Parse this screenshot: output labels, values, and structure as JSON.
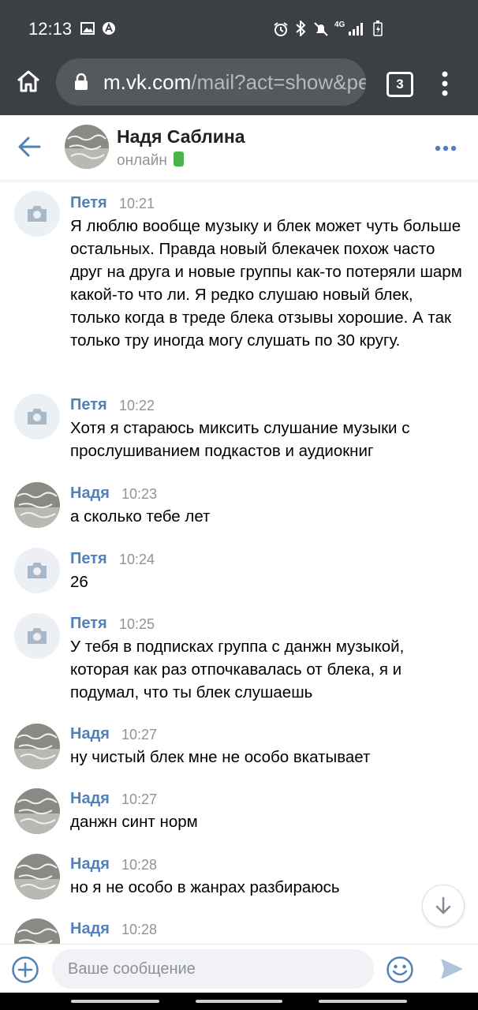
{
  "status_bar": {
    "time": "12:13",
    "network": "4G"
  },
  "browser": {
    "url_domain": "m.vk.com",
    "url_rest": "/mail?act=show&peer=",
    "tab_count": "3"
  },
  "chat_header": {
    "name": "Надя Саблина",
    "status": "онлайн"
  },
  "messages": [
    {
      "author": "Петя",
      "time": "10:21",
      "avatar": "camera",
      "text": "Я люблю вообще музыку и блек может чуть больше остальных. Правда новый блекачек похож часто друг на друга и новые группы как-то потеряли шарм какой-то что ли. Я редко слушаю новый блек, только когда в треде блека отзывы хорошие. А так только тру иногда могу слушать по 30 кругу."
    },
    {
      "author": "Петя",
      "time": "10:22",
      "avatar": "camera",
      "text": "Хотя я стараюсь миксить слушание музыки с прослушиванием подкастов и аудиокниг"
    },
    {
      "author": "Надя",
      "time": "10:23",
      "avatar": "photo",
      "text": "а сколько тебе лет"
    },
    {
      "author": "Петя",
      "time": "10:24",
      "avatar": "camera",
      "text": "26"
    },
    {
      "author": "Петя",
      "time": "10:25",
      "avatar": "camera",
      "text": "У тебя в подписках группа с данжн музыкой, которая как раз отпочкавалась от блека, я и подумал, что ты блек слушаешь"
    },
    {
      "author": "Надя",
      "time": "10:27",
      "avatar": "photo",
      "text": "ну чистый блек мне не особо вкатывает"
    },
    {
      "author": "Надя",
      "time": "10:27",
      "avatar": "photo",
      "text": "данжн синт норм"
    },
    {
      "author": "Надя",
      "time": "10:28",
      "avatar": "photo",
      "text": "но я не особо в жанрах разбираюсь"
    },
    {
      "author": "Надя",
      "time": "10:28",
      "avatar": "photo",
      "text": ""
    }
  ],
  "composer": {
    "placeholder": "Ваше сообщение",
    "value": ""
  },
  "colors": {
    "accent": "#5181b8",
    "browser_bar": "#3c3f43",
    "online": "#4bb34b"
  },
  "icons": [
    "home-icon",
    "lock-icon",
    "menu-dots-icon",
    "back-arrow-icon",
    "more-icon",
    "camera-icon",
    "arrow-down-icon",
    "add-icon",
    "emoji-icon",
    "send-icon"
  ]
}
